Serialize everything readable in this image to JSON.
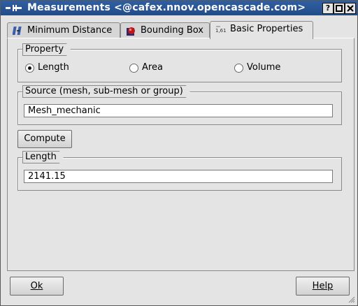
{
  "window": {
    "title": "Measurements <@cafex.nnov.opencascade.com>",
    "controls": {
      "help": "?",
      "maximize": "□",
      "close": "✕"
    }
  },
  "tabs": [
    {
      "label": "Minimum Distance",
      "icon": "minimum-distance-icon",
      "active": false
    },
    {
      "label": "Bounding Box",
      "icon": "bounding-box-icon",
      "active": false
    },
    {
      "label": "Basic Properties",
      "icon": "basic-properties-icon",
      "active": true
    }
  ],
  "property": {
    "label": "Property",
    "options": [
      {
        "label": "Length",
        "selected": true
      },
      {
        "label": "Area",
        "selected": false
      },
      {
        "label": "Volume",
        "selected": false
      }
    ]
  },
  "source": {
    "label": "Source (mesh, sub-mesh or group)",
    "value": "Mesh_mechanic"
  },
  "compute": {
    "label": "Compute"
  },
  "result": {
    "label": "Length",
    "value": "2141.15"
  },
  "footer": {
    "ok_label": "Ok",
    "help_label": "Help"
  },
  "colors": {
    "titlebar": "#2f5fa3",
    "background": "#e4e4e4"
  }
}
